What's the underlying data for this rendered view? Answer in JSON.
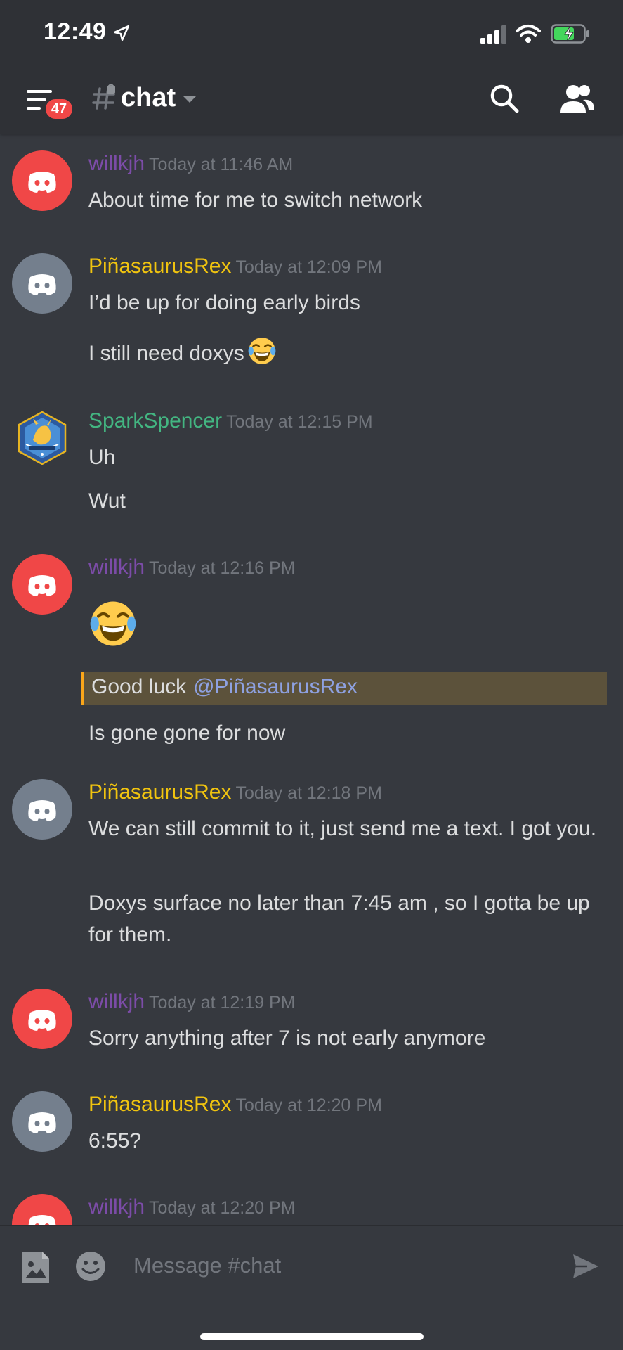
{
  "status_bar": {
    "time": "12:49"
  },
  "header": {
    "notification_count": "47",
    "channel": "chat"
  },
  "messages": [
    {
      "author": "willkjh",
      "timestamp": "Today at 11:46 AM",
      "lines": [
        "About time for me to switch network"
      ]
    },
    {
      "author": "PiñasaurusRex",
      "timestamp": "Today at 12:09 PM",
      "lines": [
        "I’d be up for doing early birds",
        "I still need doxys"
      ]
    },
    {
      "author": "SparkSpencer",
      "timestamp": "Today at 12:15 PM",
      "lines": [
        "Uh",
        "Wut"
      ]
    },
    {
      "author": "willkjh",
      "timestamp": "Today at 12:16 PM",
      "lines": [
        "Good luck",
        "@PiñasaurusRex",
        "Is gone gone for now"
      ]
    },
    {
      "author": "PiñasaurusRex",
      "timestamp": "Today at 12:18 PM",
      "lines": [
        "We can still commit to it, just send me a text. I got you.",
        "Doxys surface no later than 7:45 am , so I gotta be up for them."
      ]
    },
    {
      "author": "willkjh",
      "timestamp": "Today at 12:19 PM",
      "lines": [
        "Sorry anything after 7 is not early anymore"
      ]
    },
    {
      "author": "PiñasaurusRex",
      "timestamp": "Today at 12:20 PM",
      "lines": [
        "6:55?"
      ]
    },
    {
      "author": "willkjh",
      "timestamp": "Today at 12:20 PM",
      "lines": []
    }
  ],
  "composer": {
    "placeholder": "Message #chat"
  },
  "colors": {
    "background": "#36393f",
    "header": "#2f3136",
    "willkjh": "#7c4ca8",
    "pinasaurus": "#f1c40f",
    "spark": "#43b581",
    "mention_bg": "#5c523b",
    "badge": "#f04747"
  },
  "icons": [
    "location-arrow-icon",
    "signal-icon",
    "wifi-icon",
    "battery-icon",
    "menu-icon",
    "hash-icon",
    "caret-down-icon",
    "search-icon",
    "members-icon",
    "laughing-emoji-icon",
    "image-upload-icon",
    "emoji-icon",
    "send-icon"
  ]
}
